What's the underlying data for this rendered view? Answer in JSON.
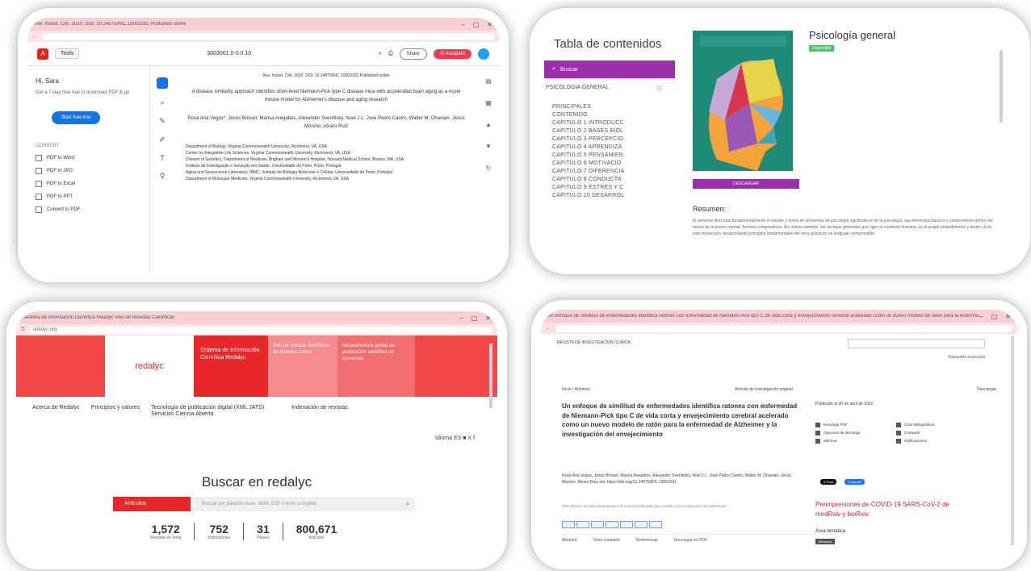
{
  "panel1": {
    "toolbar": {
      "home": "Tools",
      "file": "3003001.0-0.0.10",
      "pill_gray": "Share",
      "pill_red": "AI Assistant"
    },
    "side": {
      "greeting": "Hi, Sara",
      "sub": "Get a 7-day free trial to download PDF & go",
      "button": "Start free trial",
      "section": "CONVERT",
      "items": [
        "PDF to Word",
        "PDF to JPG",
        "PDF to Excel",
        "PDF to PPT",
        "Convert to PDF"
      ]
    },
    "doc": {
      "head": "Rev. Invest. Clin. 2020. DOI: 10.24875/RIC.19003291 Published online",
      "title": "A disease similarity approach identifies short-lived Niemann-Pick type C disease mice with accelerated brain aging as a novel mouse model for Alzheimer's disease and aging research",
      "authors": "Rosa Ana Vegas*, Jesús Brisset, Marisa Aregabes, Alexander Sventitsky, Noel J.L. Jose Pedro Castro, Walter M. Ohanian, Jesús Moreno, Alvaro Ruiz",
      "affils": [
        "Department of Biology, Virginia Commonwealth University, Richmond, VA, USA",
        "Center for Integrative Life Sciences, Virginia Commonwealth University, Richmond, VA, USA",
        "Division of Genetics, Department of Medicine, Brigham and Women's Hospital, Harvard Medical School, Boston, MA, USA",
        "Instituto de Investigação e Inovação em Saúde, Universidade do Porto, Porto, Portugal",
        "Aging and Senescence Laboratory, IBMC, Instituto de Biologia Molecular e Celular, Universidade do Porto, Portugal",
        "Department of Molecular Medicine, Virginia Commonwealth University, Richmond, VA, USA"
      ]
    }
  },
  "panel2": {
    "toc_title": "Tabla de contenidos",
    "search": "Buscar",
    "head": "PSICOLOGIA GENERAL",
    "items": [
      "PRINCIPALES",
      "CONTENIDO",
      "CAPITULO 1 INTRODUCC",
      "CAPITULO 2 BASES BIOL",
      "CAPITULO 3 PERCEPCIO",
      "CAPITULO 4 APRENDIZA",
      "CAPITULO 5 PENSAMIEN",
      "CAPITULO 6 MOTIVACIO",
      "CAPITULO 7 DIFERENCIA",
      "CAPITULO 8 CONDUCTA",
      "CAPITULO 9 ESTRES Y C",
      "CAPITULO 10 DESARROL"
    ],
    "book_title": "Psicología general",
    "badge": "Disponible",
    "download": "DESCARGAR",
    "resumen": "Resumen:",
    "resumen_text": "El presente libro trata fundamentalmente el estudio y teoría de elementos de psicología significativos de la psicología, sus elementos básicos y componentes dentro del marco de la acción normal, factores comparativos. Así mismo también, las ventajas generales que rigen la conducta humana, en el propio entendimiento y dentro de la vida interacción, desarrollando principios fundamentales del área utilizando un lenguaje comprensible."
  },
  "panel3": {
    "tab": "Sistema de Información Científica Redalyc Red de Revistas Científicas",
    "url": "redalyc.org",
    "logo": "redalyc",
    "t1": "Sistema de Información Científica Redalyc",
    "t2": "Red de revistas científicas de América Latina",
    "t3": "Infraestructura global de publicación científica no comercial",
    "nav": [
      "Acerca de Redalyc",
      "Principios y valores",
      "Tecnología de publicación digital (XML JATS) Servicios   Ciencia Abierta",
      "Indexación de revistas"
    ],
    "social": "Idioma ES ■ X f",
    "search_title": "Buscar en redalyc",
    "search_select": "Artículos",
    "search_ph": "Buscar por palabra clave, título, DOI o texto completo",
    "stats": [
      {
        "n": "1,572",
        "l": "Revistas en línea"
      },
      {
        "n": "752",
        "l": "Instituciones"
      },
      {
        "n": "31",
        "l": "Países"
      },
      {
        "n": "800,671",
        "l": "Artículos"
      }
    ]
  },
  "panel4": {
    "top": "REVISTA DE INVESTIGACION CLINICA",
    "top_r": "Búsqueda avanzada",
    "crumb": "Inicio / Archivos",
    "meta1": "Artículo de investigación original",
    "meta2": "Descargas",
    "title": "Un enfoque de similitud de enfermedades identifica ratones con enfermedad de Niemann-Pick tipo C de vida corta y envejecimiento cerebral acelerado como un nuevo modelo de ratón para la enfermedad de Alzheimer y la investigación del envejecimiento",
    "authors": "Rosa Ana Vegas, Jesús Brisset, Marisa Aregabes, Alexander Sventitsky, Noel J.L. José Pedro Castro, Walter M. Ohanian, Jesús Moreno, Alvaro Ruiz   doi: https://doi.org/10.24875/RIC.19003291",
    "note": "Este artículo se está presentando a la revista verificando que cumple con los requisitos de publicación.",
    "tabs": [
      "Abstract",
      "Texto completo",
      "Referencias",
      "Descargar en PDF"
    ],
    "pub": "Publicado el 30 de abril de 2020",
    "acts": [
      "Descarga PDF",
      "Citas bibliográficas",
      "Opciones de descarga",
      "Compartir",
      "Métricas",
      "Notificaciones"
    ],
    "x_label": "X Post",
    "f_label": "Compartir",
    "covid": "Preimpresiones de COVID-19 SARS-CoV-2 de medRxiv y bioRxiv",
    "area": "Área temática",
    "area_b": "Medicina"
  }
}
